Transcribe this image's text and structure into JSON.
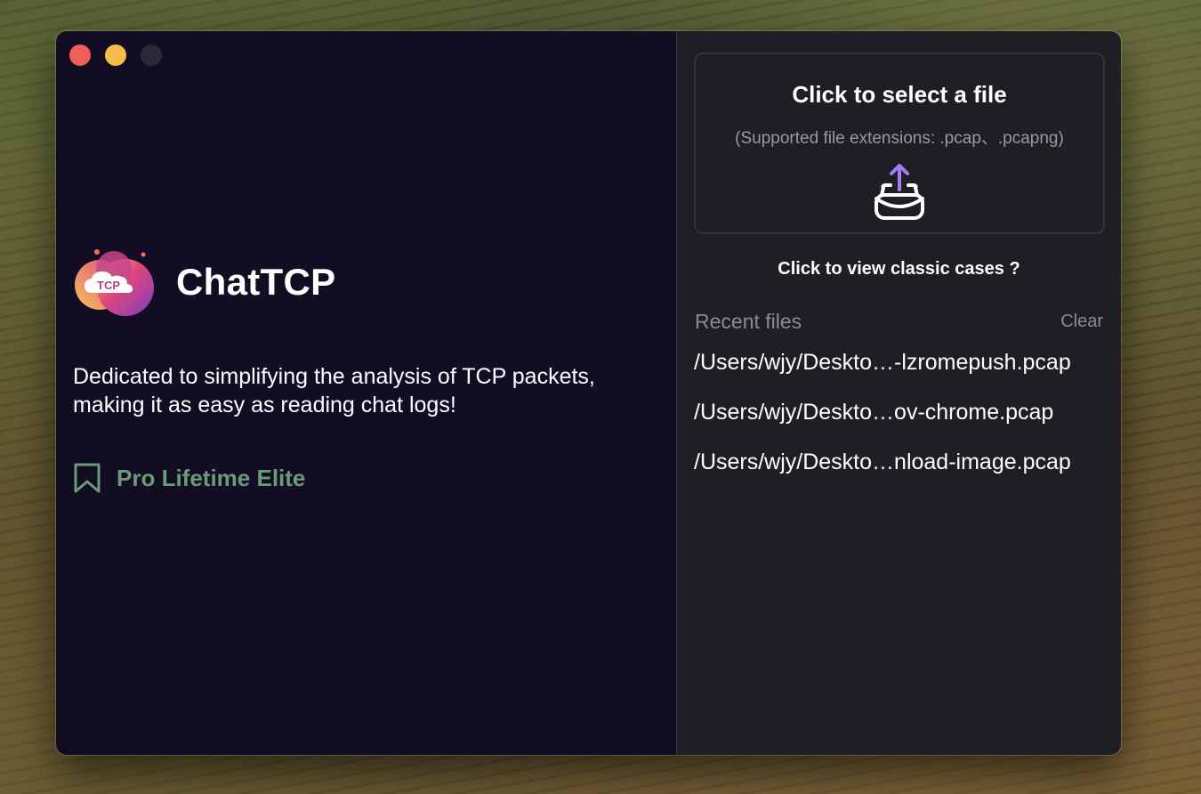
{
  "window": {
    "traffic_lights": [
      "close",
      "minimize",
      "maximize"
    ]
  },
  "left": {
    "app_name": "ChatTCP",
    "logo_text": "TCP",
    "tagline": "Dedicated to simplifying the analysis of TCP packets, making it as easy as reading chat logs!",
    "membership_icon": "bookmark-icon",
    "membership_label": "Pro Lifetime Elite"
  },
  "right": {
    "drop_zone": {
      "title": "Click to select a file",
      "subtitle": "(Supported file extensions: .pcap、.pcapng)",
      "icon": "upload-tray-icon"
    },
    "classic_cases_link": "Click to view classic cases ?",
    "recent": {
      "title": "Recent files",
      "clear_label": "Clear",
      "files": [
        "/Users/wjy/Deskto…-lzromepush.pcap",
        "/Users/wjy/Deskto…ov-chrome.pcap",
        "/Users/wjy/Deskto…nload-image.pcap"
      ]
    }
  },
  "colors": {
    "left_background": "#130d24",
    "right_background": "#1f1e24",
    "membership_accent": "#6a9a78",
    "upload_arrow": "#a77bf3",
    "close": "#ee5f57",
    "minimize": "#f5bd4f"
  }
}
